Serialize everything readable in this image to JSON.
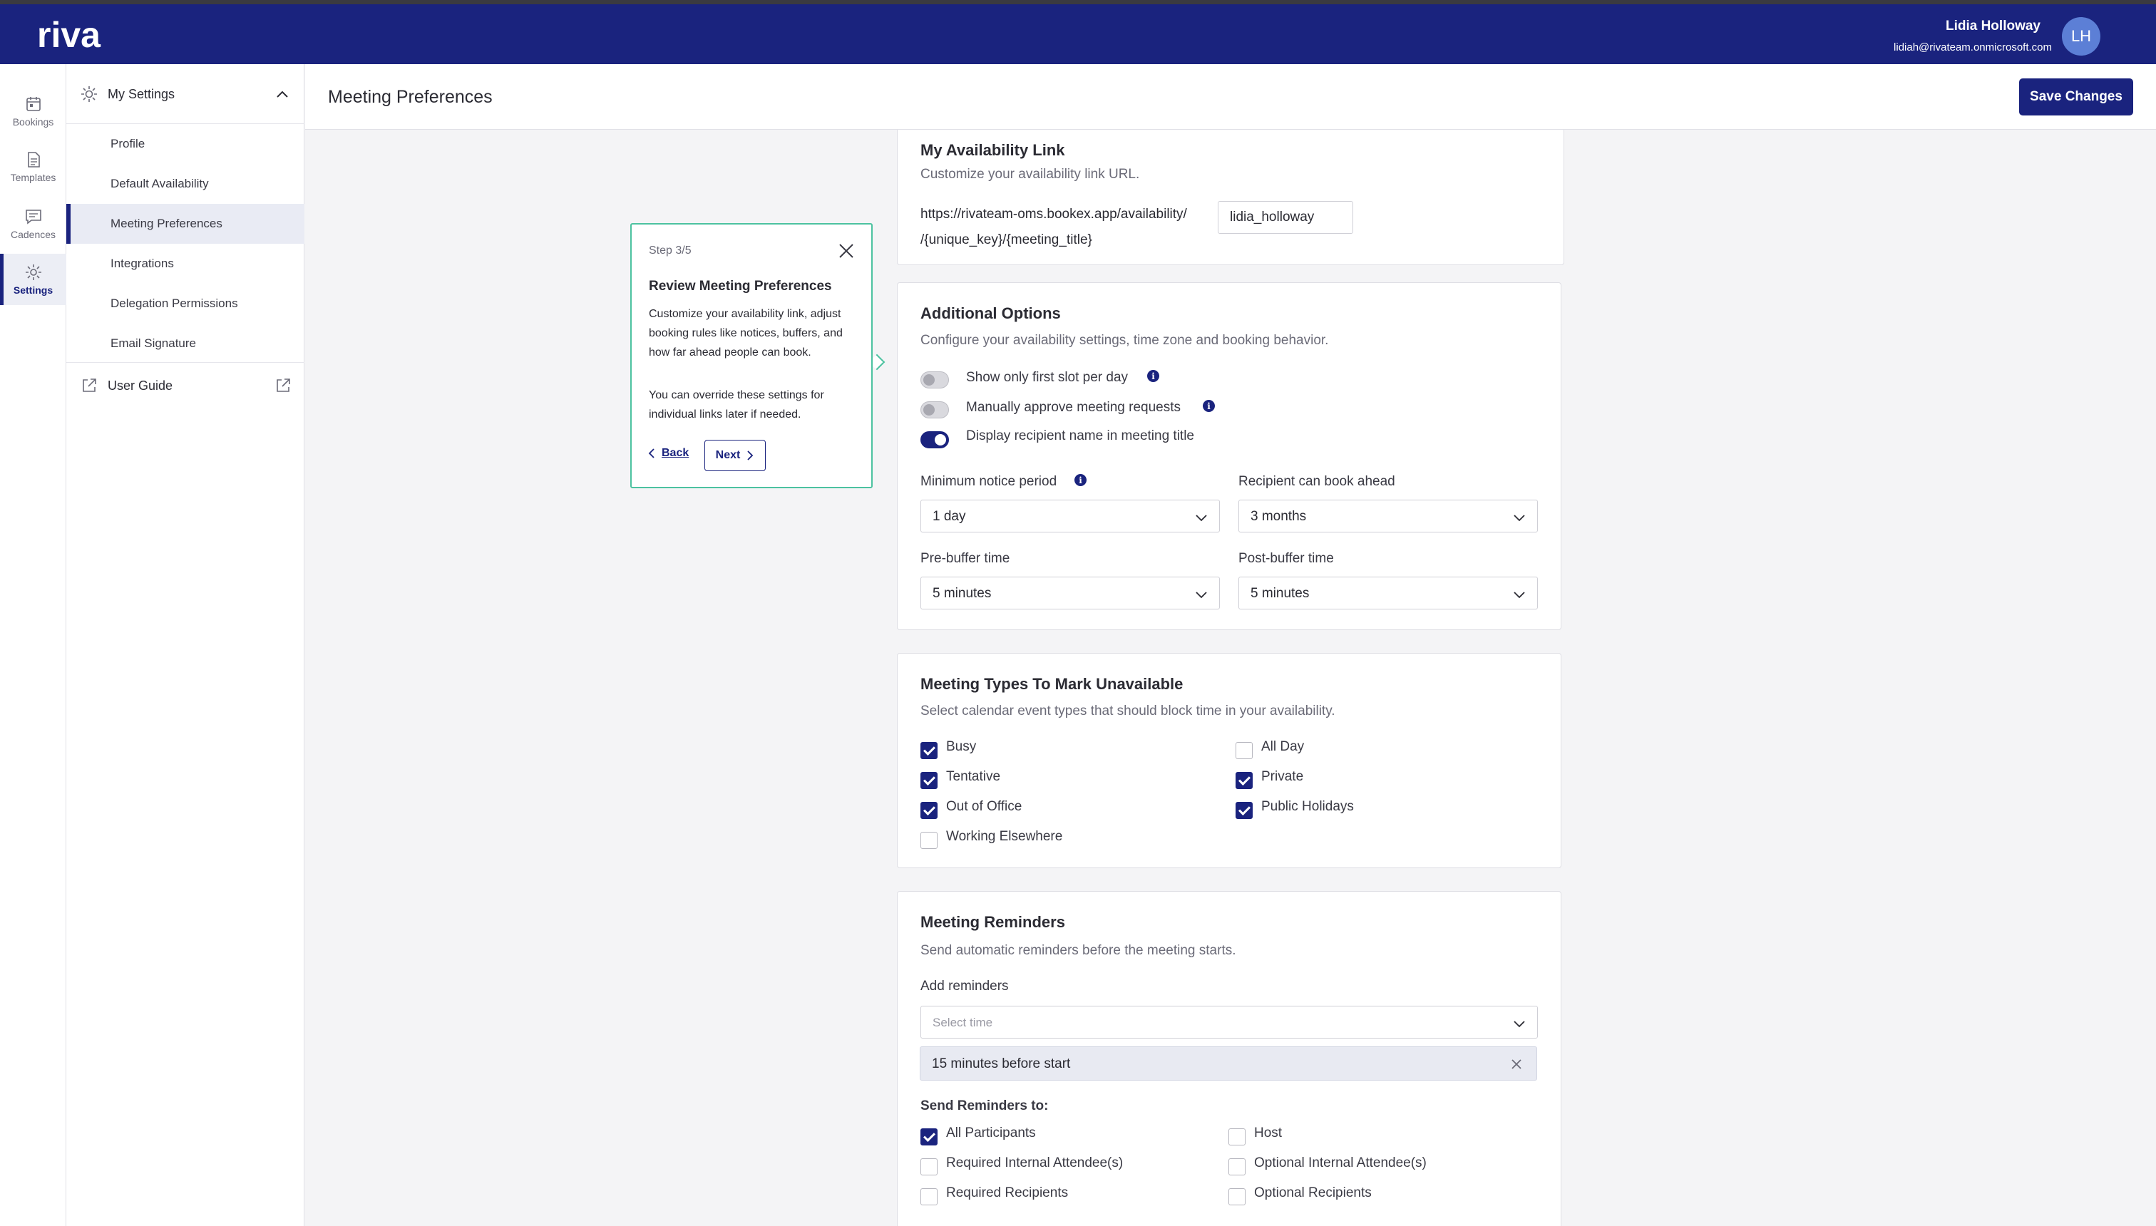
{
  "header": {
    "logo_text": "riva",
    "user_name": "Lidia Holloway",
    "user_email": "lidiah@rivateam.onmicrosoft.com",
    "avatar_initials": "LH"
  },
  "rail": {
    "items": [
      {
        "label": "Bookings",
        "icon": "calendar-icon"
      },
      {
        "label": "Templates",
        "icon": "document-icon"
      },
      {
        "label": "Cadences",
        "icon": "chat-icon"
      },
      {
        "label": "Settings",
        "icon": "gear-icon"
      }
    ]
  },
  "nav": {
    "section_label": "My Settings",
    "items": [
      {
        "label": "Profile"
      },
      {
        "label": "Default Availability"
      },
      {
        "label": "Meeting Preferences"
      },
      {
        "label": "Integrations"
      },
      {
        "label": "Delegation Permissions"
      },
      {
        "label": "Email Signature"
      }
    ],
    "guide_label": "User Guide"
  },
  "page": {
    "title": "Meeting Preferences",
    "save_label": "Save Changes"
  },
  "availability_link": {
    "title": "My Availability Link",
    "subtitle": "Customize your availability link URL.",
    "base_url": "https://rivateam-oms.bookex.app/availability/",
    "slug_value": "lidia_holloway",
    "suffix": "/{unique_key}/{meeting_title}"
  },
  "additional_options": {
    "title": "Additional Options",
    "subtitle": "Configure your availability settings, time zone and booking behavior.",
    "toggles": [
      {
        "label": "Show only first slot per day",
        "on": false
      },
      {
        "label": "Manually approve meeting requests",
        "on": false
      },
      {
        "label": "Display recipient name in meeting title",
        "on": true
      }
    ],
    "min_notice_label": "Minimum notice period",
    "min_notice_value": "1 day",
    "book_ahead_label": "Recipient can book ahead",
    "book_ahead_value": "3 months",
    "pre_buffer_label": "Pre-buffer time",
    "pre_buffer_value": "5 minutes",
    "post_buffer_label": "Post-buffer time",
    "post_buffer_value": "5 minutes"
  },
  "meeting_types": {
    "title": "Meeting Types To Mark Unavailable",
    "subtitle": "Select calendar event types that should block time in your availability.",
    "options": [
      {
        "label": "Busy",
        "checked": true
      },
      {
        "label": "All Day",
        "checked": false
      },
      {
        "label": "Tentative",
        "checked": true
      },
      {
        "label": "Private",
        "checked": true
      },
      {
        "label": "Out of Office",
        "checked": true
      },
      {
        "label": "Public Holidays",
        "checked": true
      },
      {
        "label": "Working Elsewhere",
        "checked": false
      }
    ]
  },
  "reminders": {
    "title": "Meeting Reminders",
    "subtitle": "Send automatic reminders before the meeting starts.",
    "add_label": "Add reminders",
    "select_placeholder": "Select time",
    "chip_value": "15 minutes before start",
    "send_to_label": "Send Reminders to:",
    "recipients": [
      {
        "label": "All Participants",
        "checked": true
      },
      {
        "label": "Host",
        "checked": false
      },
      {
        "label": "Required Internal Attendee(s)",
        "checked": false
      },
      {
        "label": "Optional Internal Attendee(s)",
        "checked": false
      },
      {
        "label": "Required Recipients",
        "checked": false
      },
      {
        "label": "Optional Recipients",
        "checked": false
      }
    ]
  },
  "tour": {
    "step": "Step 3/5",
    "title": "Review Meeting Preferences",
    "body1": "Customize your availability link, adjust booking rules like notices, buffers, and how far ahead people can book.",
    "body2": "You can override these settings for individual links later if needed.",
    "back_label": "Back",
    "next_label": "Next"
  },
  "colors": {
    "brand": "#1a237e",
    "tour_border": "#4cc2a0",
    "info_dot": "#1a237e"
  }
}
